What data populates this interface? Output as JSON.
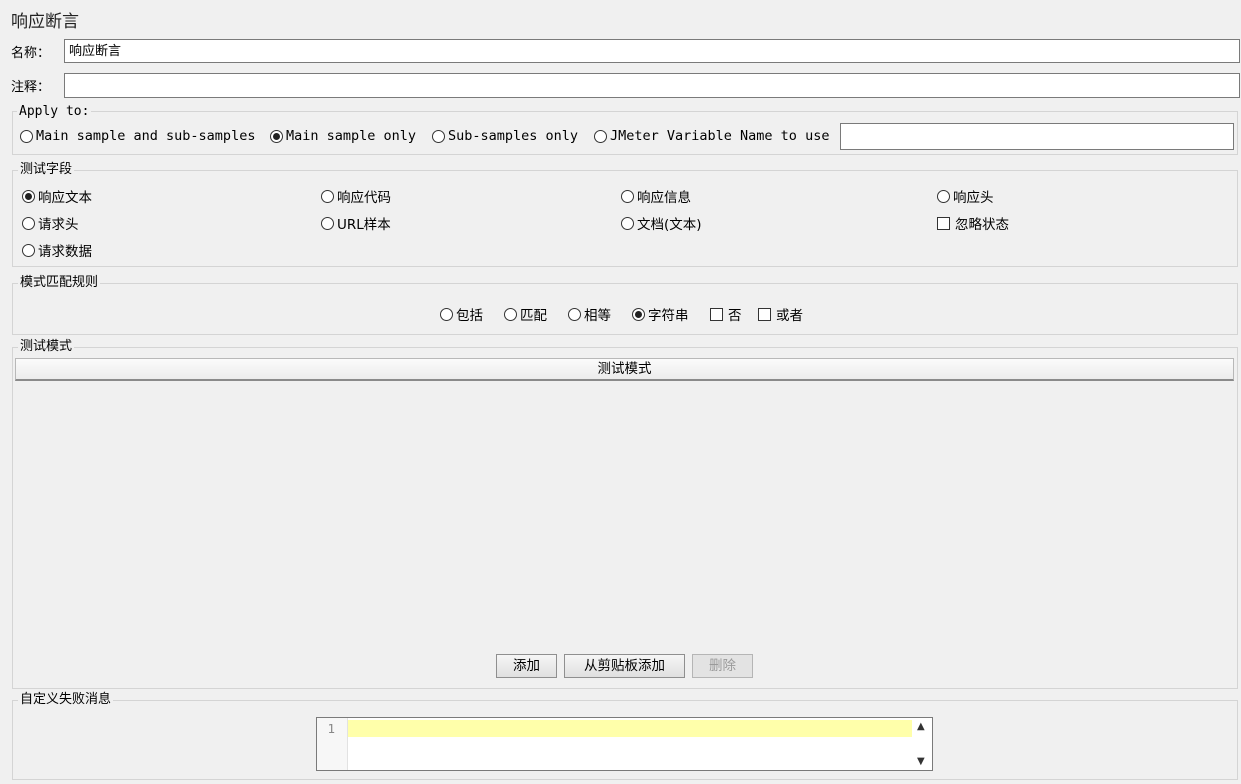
{
  "title": "响应断言",
  "name_label": "名称：",
  "name_value": "响应断言",
  "comment_label": "注释：",
  "comment_value": "",
  "apply_to": {
    "legend": "Apply to:",
    "options": [
      "Main sample and sub-samples",
      "Main sample only",
      "Sub-samples only",
      "JMeter Variable Name to use"
    ],
    "selected": "Main sample only",
    "variable_value": ""
  },
  "test_field": {
    "legend": "测试字段",
    "options": [
      "响应文本",
      "响应代码",
      "响应信息",
      "响应头",
      "请求头",
      "URL样本",
      "文档(文本)",
      "请求数据"
    ],
    "selected": "响应文本",
    "ignore_status_label": "忽略状态",
    "ignore_status_checked": false
  },
  "pattern_rules": {
    "legend": "模式匹配规则",
    "options": [
      "包括",
      "匹配",
      "相等",
      "字符串"
    ],
    "selected": "字符串",
    "not_label": "否",
    "not_checked": false,
    "or_label": "或者",
    "or_checked": false
  },
  "test_patterns": {
    "legend": "测试模式",
    "column_header": "测试模式",
    "add_button": "添加",
    "add_clipboard_button": "从剪贴板添加",
    "delete_button": "删除"
  },
  "custom_failure": {
    "legend": "自定义失败消息",
    "line_number": "1",
    "text": ""
  }
}
